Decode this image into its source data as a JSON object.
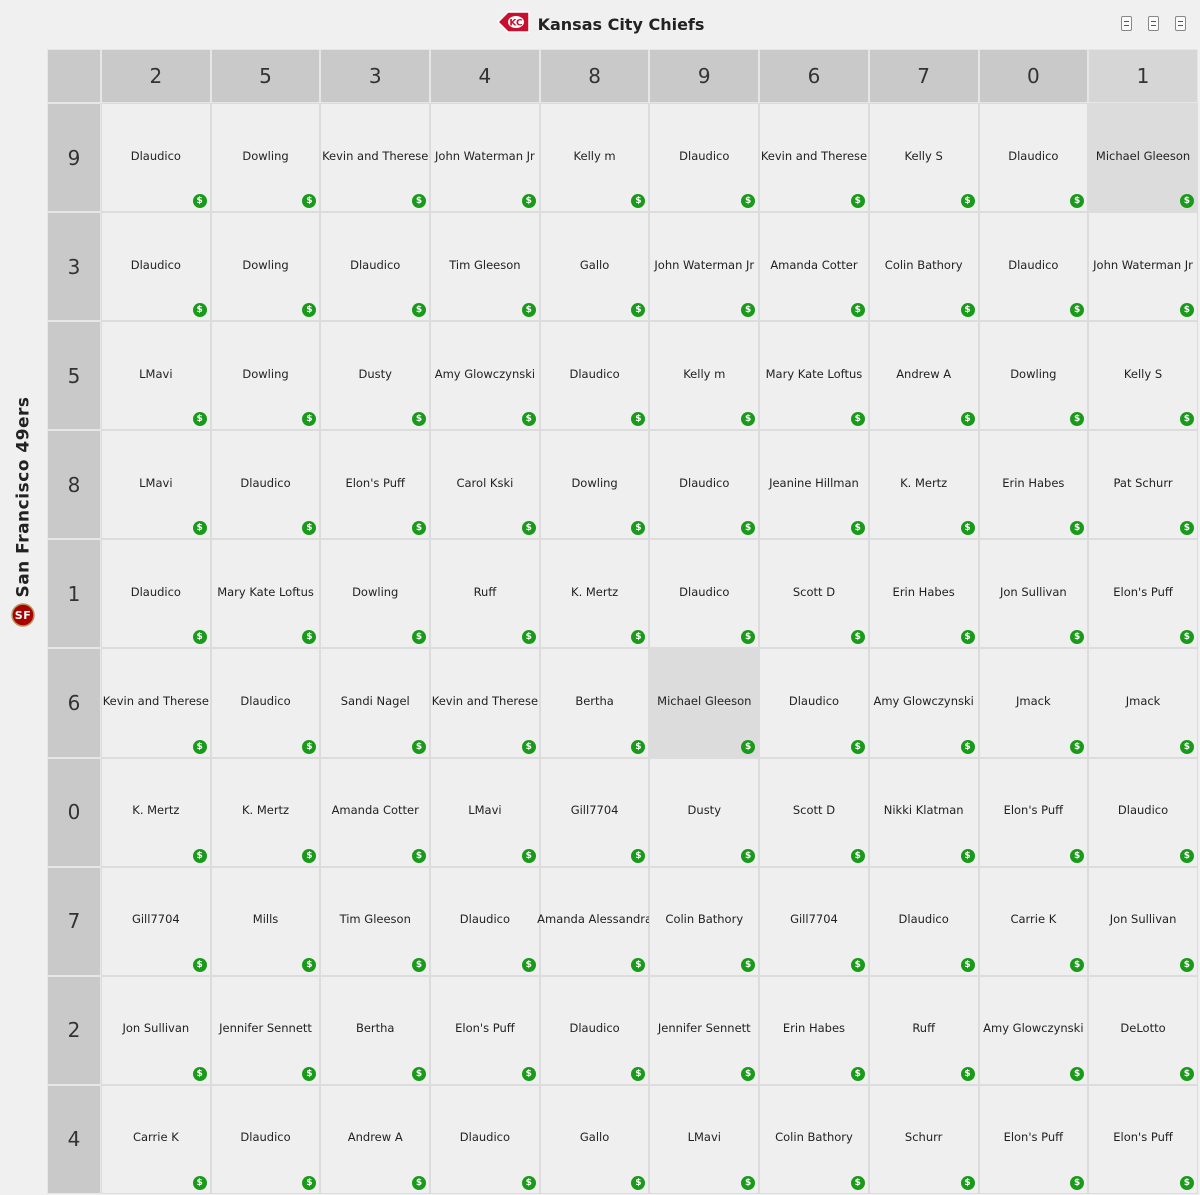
{
  "home_team": {
    "name": "Kansas City Chiefs",
    "logo": "chiefs-arrowhead-icon"
  },
  "away_team": {
    "name": "San Francisco 49ers",
    "logo": "49ers-sf-icon"
  },
  "header_tools": [
    "sort-up-icon",
    "sort-down-icon",
    "shuffle-icon"
  ],
  "col_numbers": [
    "2",
    "5",
    "3",
    "4",
    "8",
    "9",
    "6",
    "7",
    "0",
    "1"
  ],
  "row_numbers": [
    "9",
    "3",
    "5",
    "8",
    "1",
    "6",
    "0",
    "7",
    "2",
    "4"
  ],
  "paid_symbol": "$",
  "colors": {
    "header_bg": "#c9c9c9",
    "cell_bg": "#efefef",
    "highlight": "#dcdcdc",
    "paid": "#1a9a1a"
  },
  "highlighted": [
    [
      0,
      9
    ],
    [
      5,
      5
    ]
  ],
  "grid": [
    [
      "Dlaudico",
      "Dowling",
      "Kevin and Therese",
      "John Waterman Jr",
      "Kelly m",
      "Dlaudico",
      "Kevin and Therese",
      "Kelly S",
      "Dlaudico",
      "Michael Gleeson"
    ],
    [
      "Dlaudico",
      "Dowling",
      "Dlaudico",
      "Tim Gleeson",
      "Gallo",
      "John Waterman Jr",
      "Amanda Cotter",
      "Colin Bathory",
      "Dlaudico",
      "John Waterman Jr"
    ],
    [
      "LMavi",
      "Dowling",
      "Dusty",
      "Amy Glowczynski",
      "Dlaudico",
      "Kelly m",
      "Mary Kate Loftus",
      "Andrew A",
      "Dowling",
      "Kelly S"
    ],
    [
      "LMavi",
      "Dlaudico",
      "Elon's Puff",
      "Carol Kski",
      "Dowling",
      "Dlaudico",
      "Jeanine Hillman",
      "K. Mertz",
      "Erin Habes",
      "Pat Schurr"
    ],
    [
      "Dlaudico",
      "Mary Kate Loftus",
      "Dowling",
      "Ruff",
      "K. Mertz",
      "Dlaudico",
      "Scott D",
      "Erin Habes",
      "Jon Sullivan",
      "Elon's Puff"
    ],
    [
      "Kevin and Therese",
      "Dlaudico",
      "Sandi Nagel",
      "Kevin and Therese",
      "Bertha",
      "Michael Gleeson",
      "Dlaudico",
      "Amy Glowczynski",
      "Jmack",
      "Jmack"
    ],
    [
      "K. Mertz",
      "K. Mertz",
      "Amanda Cotter",
      "LMavi",
      "Gill7704",
      "Dusty",
      "Scott D",
      "Nikki Klatman",
      "Elon's Puff",
      "Dlaudico"
    ],
    [
      "Gill7704",
      "Mills",
      "Tim Gleeson",
      "Dlaudico",
      "Amanda Alessandra",
      "Colin Bathory",
      "Gill7704",
      "Dlaudico",
      "Carrie K",
      "Jon Sullivan"
    ],
    [
      "Jon Sullivan",
      "Jennifer Sennett",
      "Bertha",
      "Elon's Puff",
      "Dlaudico",
      "Jennifer Sennett",
      "Erin Habes",
      "Ruff",
      "Amy Glowczynski",
      "DeLotto"
    ],
    [
      "Carrie K",
      "Dlaudico",
      "Andrew A",
      "Dlaudico",
      "Gallo",
      "LMavi",
      "Colin Bathory",
      "Schurr",
      "Elon's Puff",
      "Elon's Puff"
    ]
  ]
}
